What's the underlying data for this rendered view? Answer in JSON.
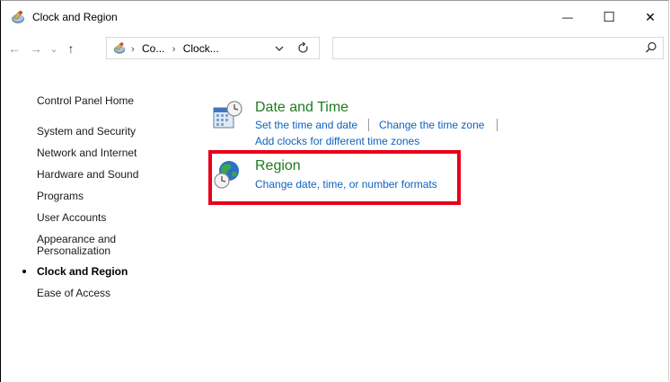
{
  "window": {
    "title": "Clock and Region",
    "controls": {
      "minimize": "—",
      "maximize": "☐",
      "close": "✕"
    }
  },
  "nav": {
    "back": "←",
    "forward": "→",
    "recent": "⌄",
    "up": "↑"
  },
  "address": {
    "crumbs": [
      "Co...",
      "Clock..."
    ],
    "separator": "›",
    "dropdown_icon": "chevron-down-icon",
    "refresh_icon": "refresh-icon"
  },
  "search": {
    "placeholder": "",
    "icon": "search-icon"
  },
  "sidebar": {
    "items": [
      {
        "label": "Control Panel Home"
      },
      {
        "label": "System and Security"
      },
      {
        "label": "Network and Internet"
      },
      {
        "label": "Hardware and Sound"
      },
      {
        "label": "Programs"
      },
      {
        "label": "User Accounts"
      },
      {
        "label": "Appearance and",
        "label2": "Personalization"
      },
      {
        "label": "Clock and Region",
        "current": true
      },
      {
        "label": "Ease of Access"
      }
    ]
  },
  "categories": {
    "date_time": {
      "title": "Date and Time",
      "icon": "calendar-clock-icon",
      "links": [
        "Set the time and date",
        "Change the time zone",
        "Add clocks for different time zones"
      ]
    },
    "region": {
      "title": "Region",
      "icon": "globe-clock-icon",
      "links": [
        "Change date, time, or number formats"
      ]
    }
  },
  "colors": {
    "category_title": "#1e7b1e",
    "link": "#0b63c1",
    "highlight": "#e8001c"
  }
}
